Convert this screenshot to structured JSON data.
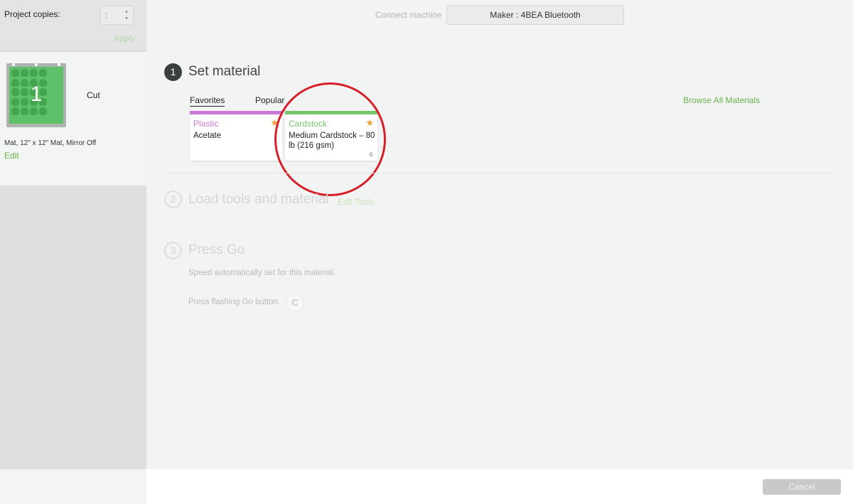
{
  "sidebar": {
    "copies_label": "Project copies:",
    "copies_value": "1",
    "apply_label": "Apply",
    "mat": {
      "number": "1",
      "action": "Cut",
      "info": "Mat, 12\" x 12\" Mat, Mirror Off",
      "edit_label": "Edit"
    }
  },
  "header": {
    "connect_label": "Connect machine",
    "machine": "Maker : 4BEA Bluetooth"
  },
  "steps": [
    {
      "number": "1",
      "title": "Set material",
      "active": true
    },
    {
      "number": "2",
      "title": "Load tools and material",
      "active": false,
      "link": "Edit Tools"
    },
    {
      "number": "3",
      "title": "Press Go",
      "active": false
    }
  ],
  "materials": {
    "tabs": [
      "Favorites",
      "Popular"
    ],
    "selected_tab": "Favorites",
    "browse_label": "Browse All Materials",
    "cards": [
      {
        "category": "Plastic",
        "name": "Acetate",
        "color": "#c97ad8"
      },
      {
        "category": "Cardstock",
        "name": "Medium Cardstock – 80 lb (216 gsm)",
        "color": "#78c46a",
        "selected": true
      }
    ]
  },
  "press_go": {
    "speed_text": "Speed automatically set for this material.",
    "press_text": "Press flashing Go button."
  },
  "footer": {
    "cancel_label": "Cancel"
  },
  "colors": {
    "accent_green": "#6cb04a",
    "highlight_red": "#d62028",
    "star_orange": "#f0a030"
  }
}
